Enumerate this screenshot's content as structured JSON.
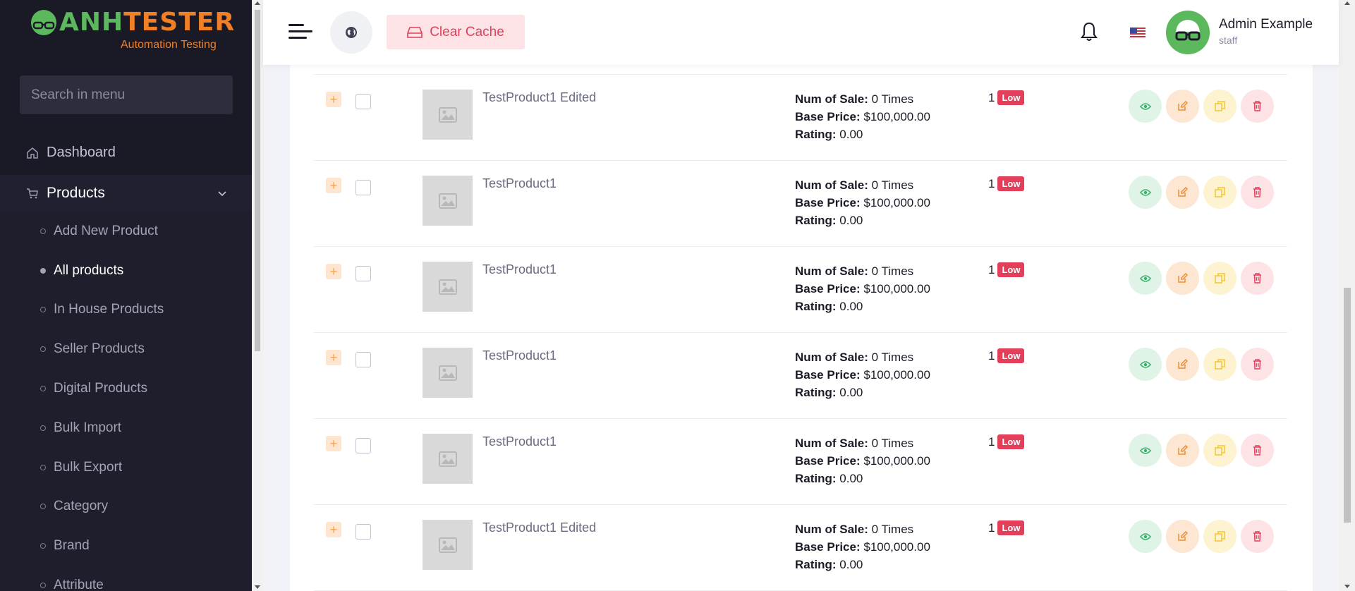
{
  "brand": {
    "logo_text_green": "ANH",
    "logo_text_orange": "TESTER",
    "tagline": "Automation Testing"
  },
  "sidebar": {
    "search_placeholder": "Search in menu",
    "dashboard_label": "Dashboard",
    "products_label": "Products",
    "submenu": [
      {
        "label": "Add New Product",
        "active": false
      },
      {
        "label": "All products",
        "active": true
      },
      {
        "label": "In House Products",
        "active": false
      },
      {
        "label": "Seller Products",
        "active": false
      },
      {
        "label": "Digital Products",
        "active": false
      },
      {
        "label": "Bulk Import",
        "active": false
      },
      {
        "label": "Bulk Export",
        "active": false
      },
      {
        "label": "Category",
        "active": false
      },
      {
        "label": "Brand",
        "active": false
      },
      {
        "label": "Attribute",
        "active": false
      }
    ]
  },
  "topbar": {
    "clear_cache_label": "Clear Cache",
    "user_name": "Admin Example",
    "user_role": "staff"
  },
  "table": {
    "labels": {
      "num_of_sale": "Num of Sale:",
      "base_price": "Base Price:",
      "rating": "Rating:"
    },
    "rows": [
      {
        "name": "TestProduct1 Edited",
        "num_of_sale": "0 Times",
        "base_price": "$100,000.00",
        "rating": "0.00",
        "qty": "1",
        "stock_badge": "Low"
      },
      {
        "name": "TestProduct1",
        "num_of_sale": "0 Times",
        "base_price": "$100,000.00",
        "rating": "0.00",
        "qty": "1",
        "stock_badge": "Low"
      },
      {
        "name": "TestProduct1",
        "num_of_sale": "0 Times",
        "base_price": "$100,000.00",
        "rating": "0.00",
        "qty": "1",
        "stock_badge": "Low"
      },
      {
        "name": "TestProduct1",
        "num_of_sale": "0 Times",
        "base_price": "$100,000.00",
        "rating": "0.00",
        "qty": "1",
        "stock_badge": "Low"
      },
      {
        "name": "TestProduct1",
        "num_of_sale": "0 Times",
        "base_price": "$100,000.00",
        "rating": "0.00",
        "qty": "1",
        "stock_badge": "Low"
      },
      {
        "name": "TestProduct1 Edited",
        "num_of_sale": "0 Times",
        "base_price": "$100,000.00",
        "rating": "0.00",
        "qty": "1",
        "stock_badge": "Low"
      }
    ]
  },
  "colors": {
    "sidebar_bg": "#1a1a27",
    "accent_red": "#e43f5a",
    "brand_green": "#5cb85c",
    "brand_orange": "#f07f26"
  },
  "icons": {
    "view": "eye-icon",
    "edit": "edit-icon",
    "copy": "copy-icon",
    "delete": "trash-icon",
    "globe": "globe-icon",
    "bell": "bell-icon",
    "flag": "us-flag-icon",
    "image_placeholder": "image-placeholder-icon"
  }
}
